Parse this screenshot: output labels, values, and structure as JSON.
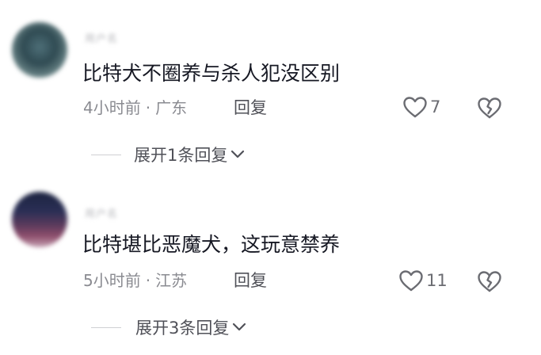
{
  "comments": [
    {
      "username": "用户名",
      "content": "比特犬不圈养与杀人犯没区别",
      "time": "4小时前",
      "location": "广东",
      "reply_label": "回复",
      "likes": "7",
      "expand_label": "展开1条回复"
    },
    {
      "username": "用户名",
      "content": "比特堪比恶魔犬，这玩意禁养",
      "time": "5小时前",
      "location": "江苏",
      "reply_label": "回复",
      "likes": "11",
      "expand_label": "展开3条回复"
    }
  ],
  "separator": "·",
  "icons": {
    "like": "heart-outline-icon",
    "dislike": "broken-heart-icon",
    "expand": "chevron-down-icon"
  },
  "colors": {
    "text_primary": "#161823",
    "text_secondary": "#8a8b91",
    "icon": "#6b6c72"
  }
}
